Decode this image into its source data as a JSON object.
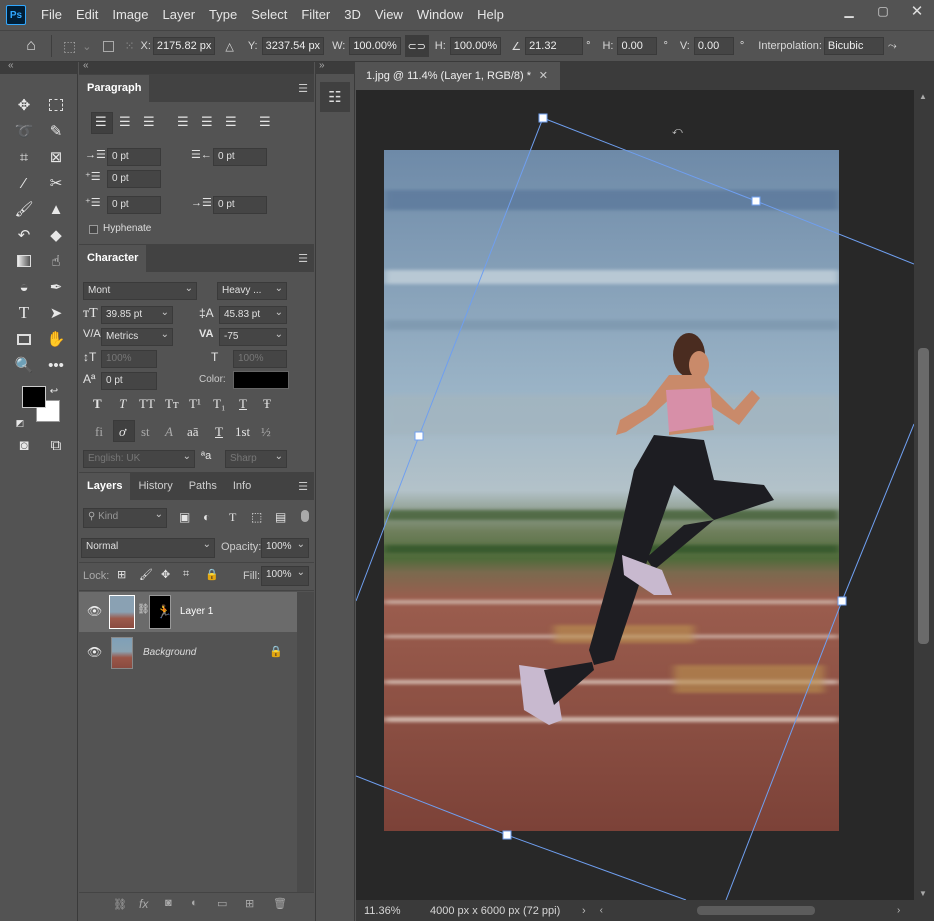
{
  "app": {
    "logo": "Ps",
    "menu": [
      "File",
      "Edit",
      "Image",
      "Layer",
      "Type",
      "Select",
      "Filter",
      "3D",
      "View",
      "Window",
      "Help"
    ],
    "window_controls": [
      "minimize-icon",
      "maximize-icon",
      "close-icon"
    ]
  },
  "options_bar": {
    "x_label": "X:",
    "x_value": "2175.82 px",
    "y_label": "Y:",
    "y_value": "3237.54 px",
    "w_label": "W:",
    "w_value": "100.00%",
    "h_label": "H:",
    "h_value": "100.00%",
    "angle_value": "21.32",
    "deg": "°",
    "hskew_label": "H:",
    "hskew_value": "0.00",
    "vskew_label": "V:",
    "vskew_value": "0.00",
    "interp_label": "Interpolation:",
    "interp_value": "Bicubic"
  },
  "paragraph": {
    "tab": "Paragraph",
    "indent_left": "0 pt",
    "indent_right": "0 pt",
    "indent_first": "0 pt",
    "space_before": "0 pt",
    "space_after": "0 pt",
    "hyphenate": "Hyphenate"
  },
  "character": {
    "tab": "Character",
    "font_family": "Mont",
    "font_style": "Heavy ...",
    "size": "39.85 pt",
    "leading": "45.83 pt",
    "kerning": "Metrics",
    "tracking": "-75",
    "vscale": "100%",
    "hscale": "100%",
    "baseline": "0 pt",
    "color_label": "Color:",
    "color": "#000000",
    "language": "English: UK",
    "aa_glyph": "ªa",
    "antialias": "Sharp",
    "style_buttons": [
      "T",
      "T",
      "TT",
      "Tт",
      "T¹",
      "T₁",
      "T",
      "Ŧ"
    ],
    "opentype_buttons": [
      "fi",
      "ơ",
      "st",
      "A",
      "aā",
      "T",
      "1st",
      "½"
    ]
  },
  "layers": {
    "tabs": [
      "Layers",
      "History",
      "Paths",
      "Info"
    ],
    "filter_kind": "Kind",
    "blend_mode": "Normal",
    "opacity_label": "Opacity:",
    "opacity": "100%",
    "lock_label": "Lock:",
    "fill_label": "Fill:",
    "fill": "100%",
    "items": [
      {
        "name": "Layer 1",
        "selected": true
      },
      {
        "name": "Background",
        "locked": true
      }
    ]
  },
  "document": {
    "tab_title": "1.jpg @ 11.4% (Layer 1, RGB/8) *",
    "zoom": "11.36%",
    "doc_info": "4000 px x 6000 px (72 ppi)"
  },
  "colors": {
    "foreground": "#000000",
    "background": "#ffffff",
    "selection": "#6b6b6b",
    "accent": "#31a8ff"
  }
}
